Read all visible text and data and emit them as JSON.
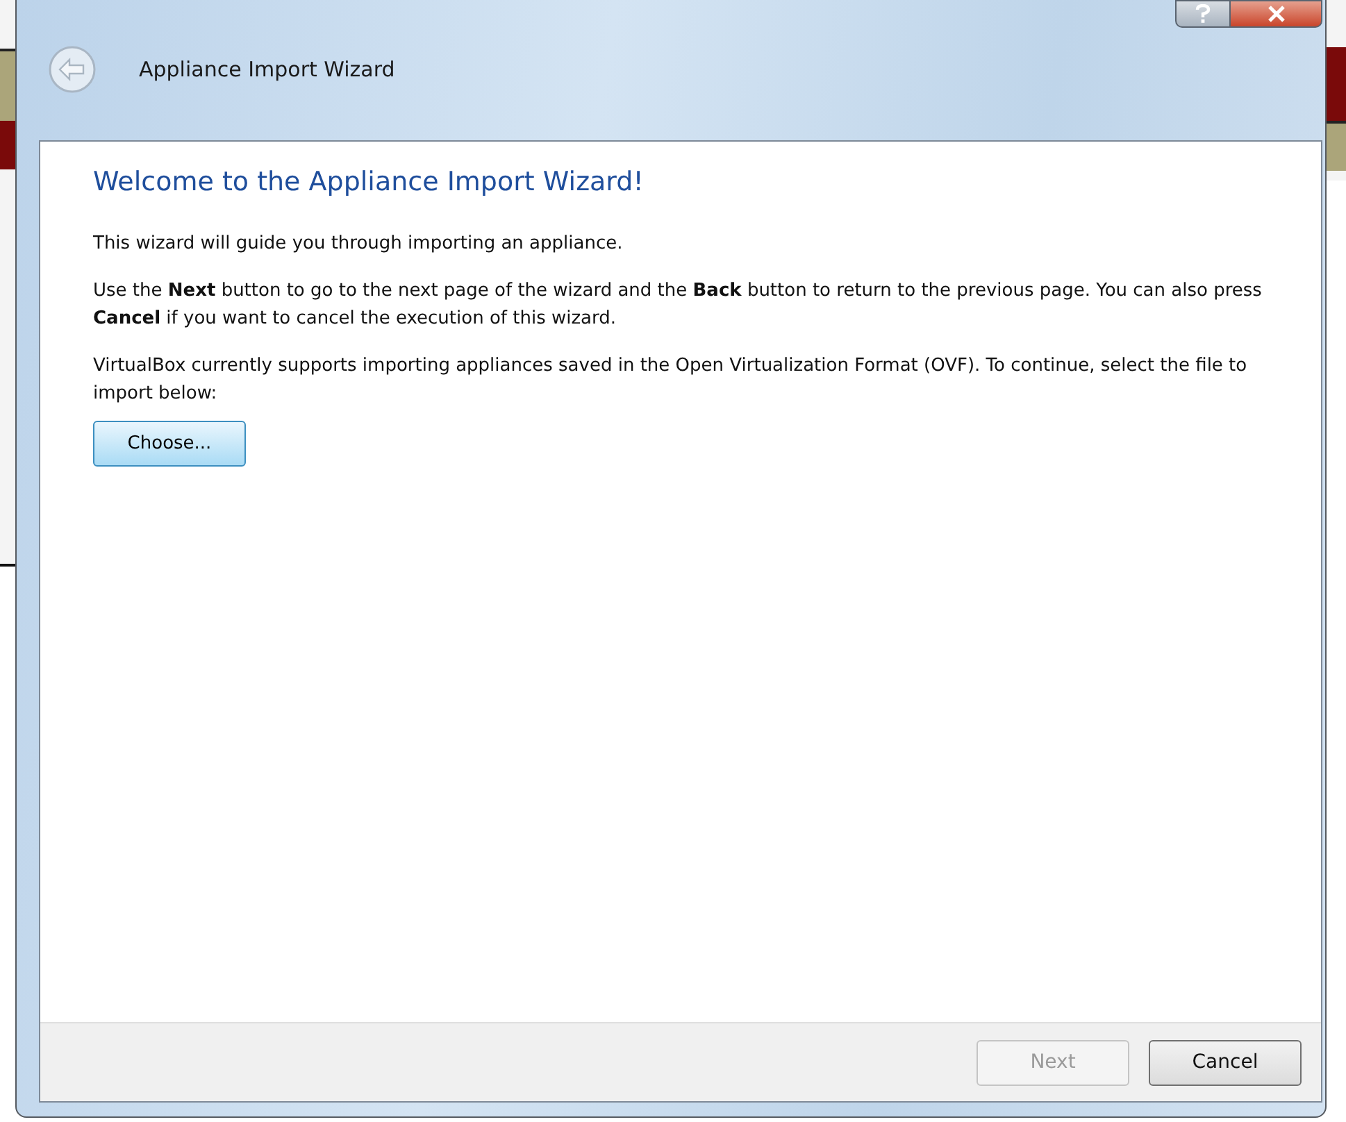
{
  "window": {
    "title": "Appliance Import Wizard"
  },
  "page": {
    "heading": "Welcome to the Appliance Import Wizard!",
    "paragraphs": [
      "This wizard will guide you through importing an appliance.",
      "Use the **Next** button to go to the next page of the wizard and the **Back** button to return to the previous page. You can also press **Cancel** if you want to cancel the execution of this wizard.",
      "VirtualBox currently supports importing appliances saved in the Open Virtualization Format (OVF). To continue, select the file to import below:"
    ],
    "choose_button": {
      "label": "Choose..."
    }
  },
  "buttons": [
    {
      "label": "Next",
      "disabled": true
    },
    {
      "label": "Cancel",
      "disabled": false
    }
  ]
}
